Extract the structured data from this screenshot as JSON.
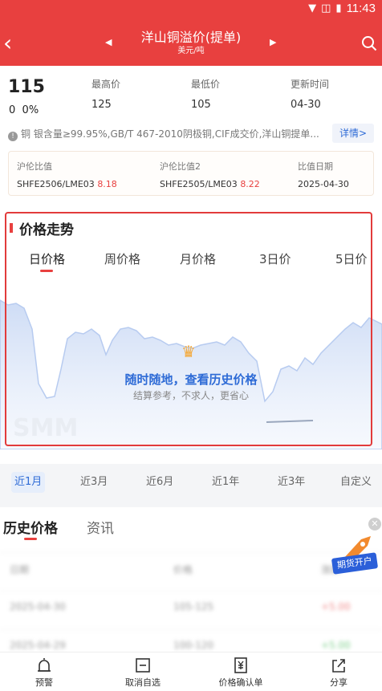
{
  "status": {
    "time": "11:43"
  },
  "header": {
    "title": "洋山铜溢价(提单)",
    "subtitle": "美元/吨"
  },
  "summary": {
    "price": "115",
    "change": "0",
    "change_pct": "0%",
    "high_label": "最高价",
    "high": "125",
    "low_label": "最低价",
    "low": "105",
    "update_label": "更新时间",
    "update": "04-30",
    "description": "铜 银含量≥99.95%,GB/T 467-2010阴极铜,CIF成交价,洋山铜提单...",
    "detail_label": "详情>"
  },
  "ratios": [
    {
      "label": "沪伦比值",
      "contract": "SHFE2506/LME03",
      "value": "8.18"
    },
    {
      "label": "沪伦比值2",
      "contract": "SHFE2505/LME03",
      "value": "8.22"
    },
    {
      "label": "比值日期",
      "value": "2025-04-30"
    }
  ],
  "trend": {
    "title": "价格走势",
    "tabs": [
      "日价格",
      "周价格",
      "月价格",
      "3日价",
      "5日价"
    ],
    "promo_main": "随时随地，查看历史价格",
    "promo_sub": "结算参考，不求人，更省心",
    "watermark": "SMM"
  },
  "ranges": [
    "近1月",
    "近3月",
    "近6月",
    "近1年",
    "近3年",
    "自定义"
  ],
  "history": {
    "tabs": [
      "历史价格",
      "资讯"
    ],
    "rows": [
      [
        "日期",
        "价格",
        "涨跌"
      ],
      [
        "2025-04-30",
        "105-125",
        "+5.00"
      ],
      [
        "2025-04-29",
        "100-120",
        "+5.00"
      ]
    ],
    "futures_label": "期货开户"
  },
  "bottom": [
    "预警",
    "取消自选",
    "价格确认单",
    "分享"
  ],
  "colors": {
    "brand": "#e8403f",
    "link": "#2e6bd6",
    "chart_fill": "#d9e4f7"
  }
}
